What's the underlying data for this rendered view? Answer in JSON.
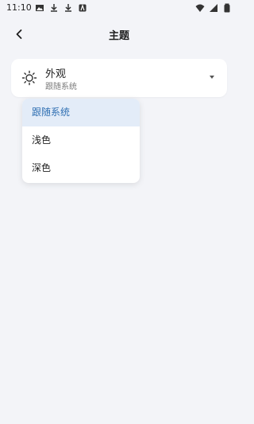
{
  "status_bar": {
    "time": "11:10",
    "left_icons": [
      "image-icon",
      "download-icon",
      "download-icon",
      "app-icon"
    ],
    "right_icons": [
      "wifi-icon",
      "signal-icon",
      "battery-icon"
    ]
  },
  "app_bar": {
    "title": "主题",
    "back_icon": "chevron-left-icon"
  },
  "setting": {
    "icon": "sun-icon",
    "title": "外观",
    "value": "跟随系统"
  },
  "menu": {
    "selected_index": 0,
    "options": [
      "跟随系统",
      "浅色",
      "深色"
    ]
  },
  "colors": {
    "background": "#f3f4f8",
    "accent": "#2f6fb2",
    "selected_bg": "#e3ecf8"
  }
}
